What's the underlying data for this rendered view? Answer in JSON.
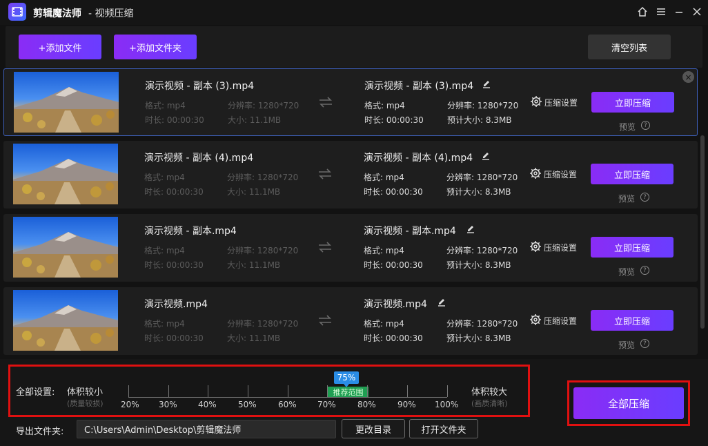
{
  "app": {
    "name": "剪辑魔法师",
    "subtitle": "- 视频压缩",
    "logo_icon": "film-icon"
  },
  "toolbar": {
    "add_file": "+添加文件",
    "add_folder": "+添加文件夹",
    "clear_list": "清空列表"
  },
  "files": [
    {
      "source_name": "演示视频 - 副本 (3).mp4",
      "format": "格式: mp4",
      "resolution": "分辨率: 1280*720",
      "duration": "时长: 00:00:30",
      "size": "大小: 11.1MB",
      "output_name": "演示视频 - 副本 (3).mp4",
      "out_format": "格式: mp4",
      "out_resolution": "分辨率: 1280*720",
      "out_duration": "时长: 00:00:30",
      "out_size": "预计大小: 8.3MB"
    },
    {
      "source_name": "演示视频 - 副本 (4).mp4",
      "format": "格式: mp4",
      "resolution": "分辨率: 1280*720",
      "duration": "时长: 00:00:30",
      "size": "大小: 11.1MB",
      "output_name": "演示视频 - 副本 (4).mp4",
      "out_format": "格式: mp4",
      "out_resolution": "分辨率: 1280*720",
      "out_duration": "时长: 00:00:30",
      "out_size": "预计大小: 8.3MB"
    },
    {
      "source_name": "演示视频 - 副本.mp4",
      "format": "格式: mp4",
      "resolution": "分辨率: 1280*720",
      "duration": "时长: 00:00:30",
      "size": "大小: 11.1MB",
      "output_name": "演示视频 - 副本.mp4",
      "out_format": "格式: mp4",
      "out_resolution": "分辨率: 1280*720",
      "out_duration": "时长: 00:00:30",
      "out_size": "预计大小: 8.3MB"
    },
    {
      "source_name": "演示视频.mp4",
      "format": "格式: mp4",
      "resolution": "分辨率: 1280*720",
      "duration": "时长: 00:00:30",
      "size": "大小: 11.1MB",
      "output_name": "演示视频.mp4",
      "out_format": "格式: mp4",
      "out_resolution": "分辨率: 1280*720",
      "out_duration": "时长: 00:00:30",
      "out_size": "预计大小: 8.3MB"
    }
  ],
  "row_labels": {
    "settings": "压缩设置",
    "compress_now": "立即压缩",
    "preview": "预览",
    "help": "?"
  },
  "global_settings": {
    "label": "全部设置:",
    "small_label": "体积较小",
    "small_hint": "(质量较损)",
    "large_label": "体积较大",
    "large_hint": "(画质清晰)",
    "ticks": [
      "20%",
      "30%",
      "40%",
      "50%",
      "60%",
      "70%",
      "80%",
      "90%",
      "100%"
    ],
    "value": "75%",
    "value_fraction": 0.75,
    "recommended": "推荐范围"
  },
  "compress_all": "全部压缩",
  "output": {
    "label": "导出文件夹:",
    "path": "C:\\Users\\Admin\\Desktop\\剪辑魔法师",
    "change_dir": "更改目录",
    "open_folder": "打开文件夹"
  },
  "colors": {
    "accent": "#8a2cf5",
    "highlight_box": "#e01010",
    "badge": "#2a8de6",
    "recommended": "#1f9e52"
  }
}
